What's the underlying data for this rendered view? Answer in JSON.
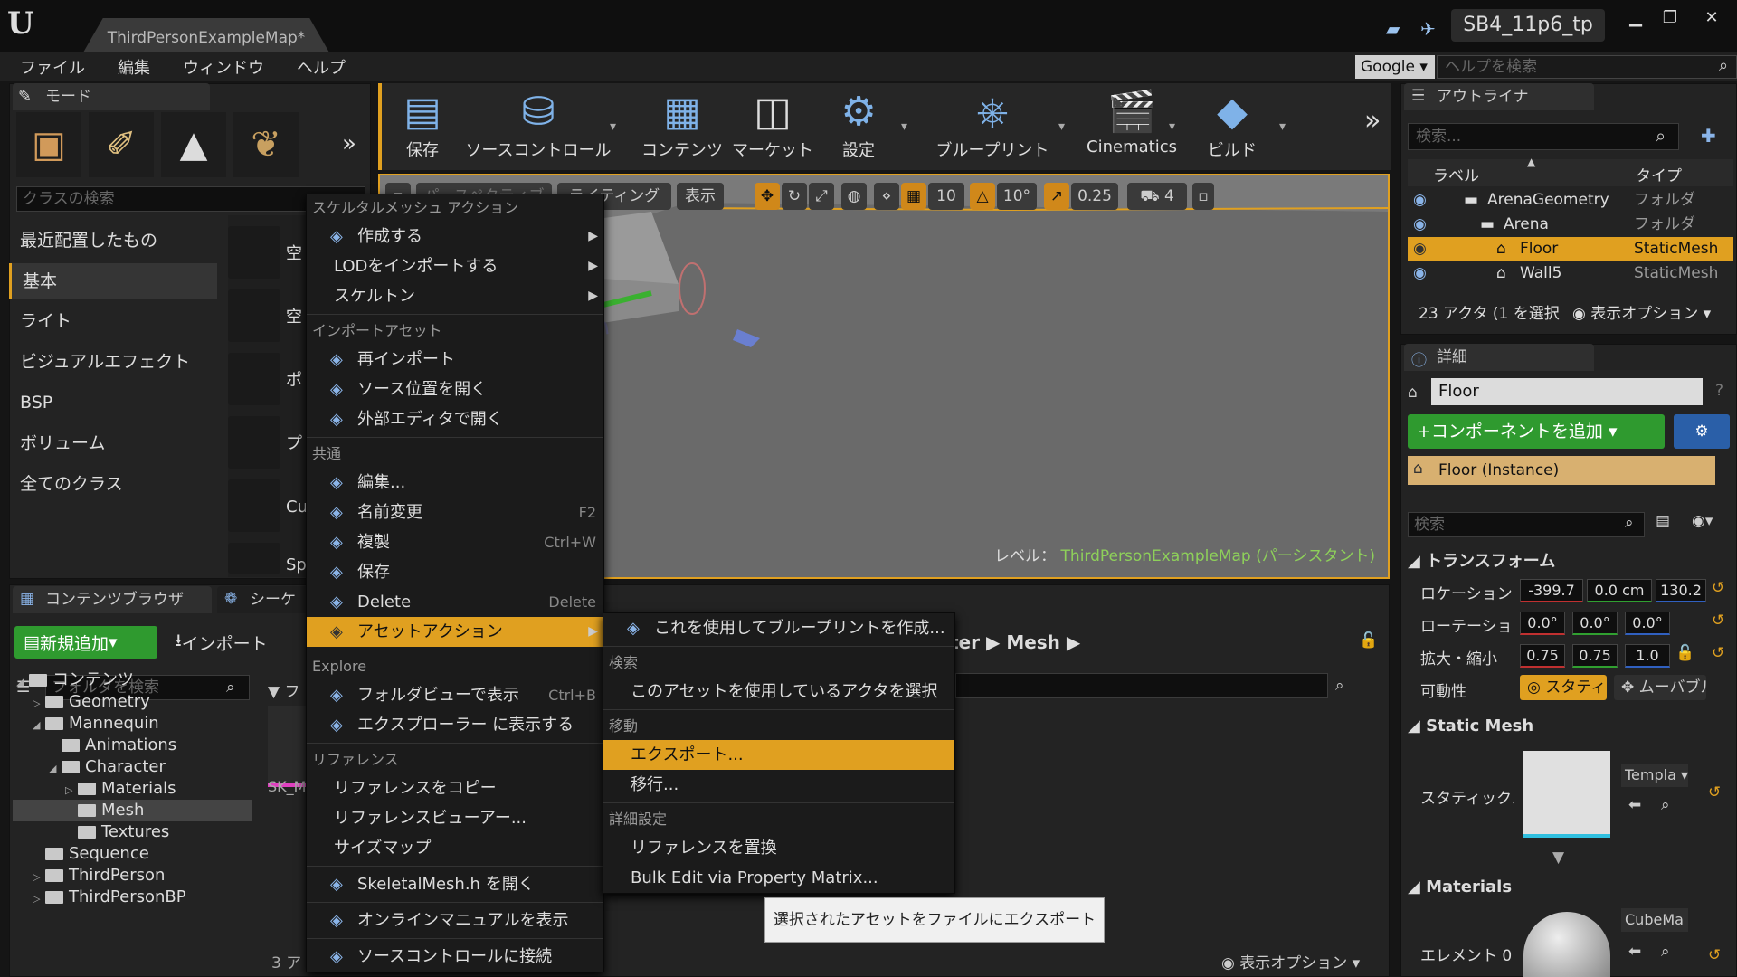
{
  "app": {
    "logo": "U",
    "doc_tab": "ThirdPersonExampleMap*",
    "project": "SB4_11p6_tp"
  },
  "menubar": {
    "items": [
      "ファイル",
      "編集",
      "ウィンドウ",
      "ヘルプ"
    ],
    "search_engine": "Google",
    "help_placeholder": "ヘルプを検索"
  },
  "modes": {
    "tab": "モード",
    "search_placeholder": "クラスの検索",
    "categories": [
      "最近配置したもの",
      "基本",
      "ライト",
      "ビジュアルエフェクト",
      "BSP",
      "ボリューム",
      "全てのクラス"
    ],
    "items": [
      "空",
      "空",
      "ポ",
      "プ",
      "Cu",
      "Sp"
    ]
  },
  "toolbar": {
    "buttons": [
      "保存",
      "ソースコントロール",
      "コンテンツ",
      "マーケット",
      "設定",
      "ブループリント",
      "Cinematics",
      "ビルド"
    ],
    "more": "»"
  },
  "viewport": {
    "chips": [
      "パースペクティブ",
      "ライティング",
      "表示"
    ],
    "grid_snap": "10",
    "rot_snap": "10°",
    "scale_snap": "0.25",
    "cam_speed": "4",
    "level_prefix": "レベル：",
    "level_name": "ThirdPersonExampleMap (パーシスタント)"
  },
  "content_browser": {
    "tabs": [
      "コンテンツブラウザ",
      "シーケ"
    ],
    "add_new": "新規追加",
    "import": "インポート",
    "folder_search": "フォルダを検索",
    "path": [
      "ter",
      "Mesh"
    ],
    "count": "3 ア",
    "view_options": "表示オプション",
    "asset_name": "SK_Manne",
    "tree": [
      {
        "label": "コンテンツ",
        "depth": 0,
        "expanded": true
      },
      {
        "label": "Geometry",
        "depth": 1,
        "expanded": false
      },
      {
        "label": "Mannequin",
        "depth": 1,
        "expanded": true
      },
      {
        "label": "Animations",
        "depth": 2,
        "expanded": null
      },
      {
        "label": "Character",
        "depth": 2,
        "expanded": true
      },
      {
        "label": "Materials",
        "depth": 3,
        "expanded": false
      },
      {
        "label": "Mesh",
        "depth": 3,
        "expanded": null,
        "selected": true
      },
      {
        "label": "Textures",
        "depth": 3,
        "expanded": null
      },
      {
        "label": "Sequence",
        "depth": 1,
        "expanded": null
      },
      {
        "label": "ThirdPerson",
        "depth": 1,
        "expanded": false
      },
      {
        "label": "ThirdPersonBP",
        "depth": 1,
        "expanded": false
      }
    ]
  },
  "context_menu": {
    "sections": [
      {
        "header": "スケルタルメッシュ アクション",
        "items": [
          {
            "label": "作成する",
            "sub": true,
            "icon": "create-icon"
          },
          {
            "label": "LODをインポートする",
            "sub": true
          },
          {
            "label": "スケルトン",
            "sub": true
          }
        ]
      },
      {
        "header": "インポートアセット",
        "items": [
          {
            "label": "再インポート",
            "icon": "reimport-icon"
          },
          {
            "label": "ソース位置を開く",
            "icon": "open-source-icon"
          },
          {
            "label": "外部エディタで開く",
            "icon": "external-editor-icon"
          }
        ]
      },
      {
        "header": "共通",
        "items": [
          {
            "label": "編集...",
            "icon": "edit-icon"
          },
          {
            "label": "名前変更",
            "shortcut": "F2",
            "icon": "rename-icon"
          },
          {
            "label": "複製",
            "shortcut": "Ctrl+W",
            "icon": "duplicate-icon"
          },
          {
            "label": "保存",
            "icon": "save-icon"
          },
          {
            "label": "Delete",
            "shortcut": "Delete",
            "icon": "delete-icon"
          },
          {
            "label": "アセットアクション",
            "sub": true,
            "highlight": true,
            "icon": "asset-action-icon"
          }
        ]
      },
      {
        "header": "Explore",
        "items": [
          {
            "label": "フォルダビューで表示",
            "shortcut": "Ctrl+B",
            "icon": "folder-view-icon"
          },
          {
            "label": "エクスプローラー に表示する",
            "icon": "explorer-icon"
          }
        ]
      },
      {
        "header": "リファレンス",
        "items": [
          {
            "label": "リファレンスをコピー"
          },
          {
            "label": "リファレンスビューアー..."
          },
          {
            "label": "サイズマップ"
          }
        ]
      },
      {
        "header": "",
        "items": [
          {
            "label": "SkeletalMesh.h を開く",
            "icon": "code-icon"
          }
        ]
      },
      {
        "header": "",
        "items": [
          {
            "label": "オンラインマニュアルを表示",
            "icon": "help-icon"
          }
        ]
      },
      {
        "header": "",
        "items": [
          {
            "label": "ソースコントロールに接続",
            "icon": "source-control-icon"
          }
        ]
      }
    ]
  },
  "submenu": {
    "sections": [
      {
        "header": "",
        "items": [
          {
            "label": "これを使用してブループリントを作成...",
            "icon": "blueprint-icon"
          }
        ]
      },
      {
        "header": "検索",
        "items": [
          {
            "label": "このアセットを使用しているアクタを選択"
          }
        ]
      },
      {
        "header": "移動",
        "items": [
          {
            "label": "エクスポート...",
            "highlight": true
          },
          {
            "label": "移行..."
          }
        ]
      },
      {
        "header": "詳細設定",
        "items": [
          {
            "label": "リファレンスを置換"
          },
          {
            "label": "Bulk Edit via Property Matrix..."
          }
        ]
      }
    ]
  },
  "tooltip": "選択されたアセットをファイルにエクスポート",
  "outliner": {
    "tab": "アウトライナ",
    "search_placeholder": "検索...",
    "col_label": "ラベル",
    "col_type": "タイプ",
    "rows": [
      {
        "label": "ArenaGeometry",
        "type": "フォルダ",
        "depth": 1
      },
      {
        "label": "Arena",
        "type": "フォルダ",
        "depth": 2
      },
      {
        "label": "Floor",
        "type": "StaticMesh",
        "depth": 3,
        "selected": true
      },
      {
        "label": "Wall5",
        "type": "StaticMesh",
        "depth": 3
      }
    ],
    "status": "23 アクタ (1 を選択",
    "view_options": "表示オプション"
  },
  "details": {
    "tab": "詳細",
    "name": "Floor",
    "add_component": "+コンポーネントを追加",
    "instance": "Floor (Instance)",
    "search_placeholder": "検索",
    "transform_header": "トランスフォーム",
    "location_label": "ロケーション",
    "rotation_label": "ローテーション",
    "scale_label": "拡大・縮小",
    "location": [
      "-399.7",
      "0.0 cm",
      "130.2"
    ],
    "rotation": [
      "0.0°",
      "0.0°",
      "0.0°"
    ],
    "scale": [
      "0.75",
      "0.75",
      "1.0"
    ],
    "mobility_label": "可動性",
    "mobility_static": "スタティック",
    "mobility_movable": "ムーバブル",
    "static_mesh_header": "Static Mesh",
    "static_mesh_label": "スタティックメッシュ",
    "static_mesh_value": "Templa",
    "materials_header": "Materials",
    "element_label": "エレメント 0",
    "material_value": "CubeMa"
  }
}
